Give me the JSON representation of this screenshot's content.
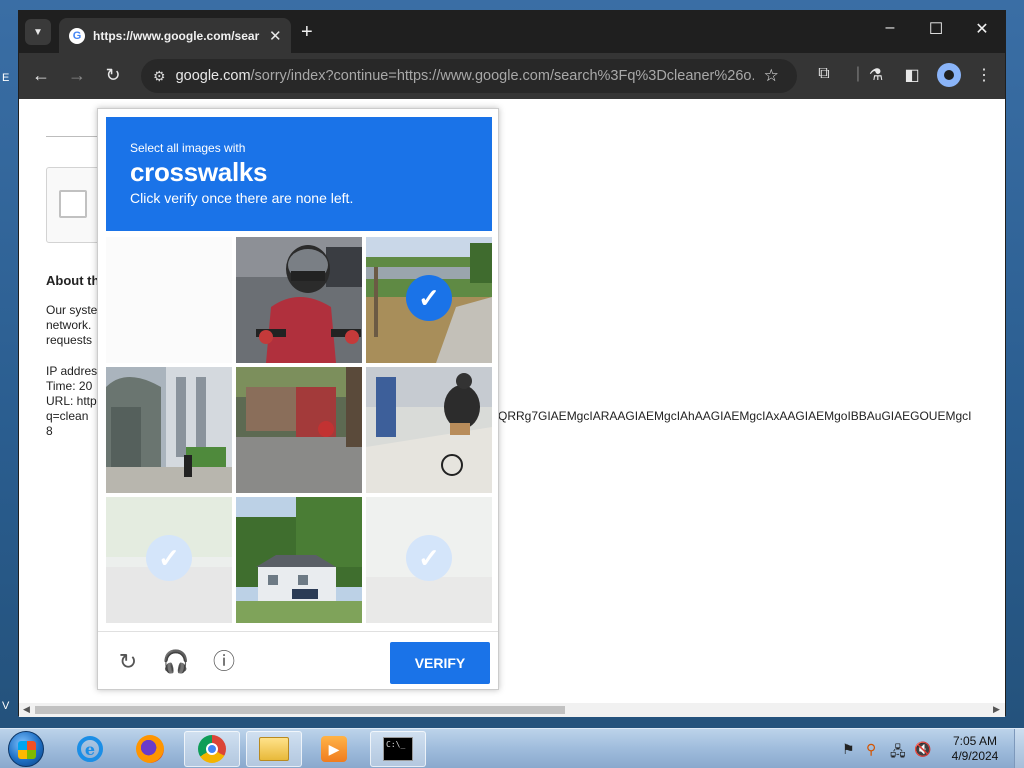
{
  "desktop": {
    "stub_left_1": "E",
    "stub_left_2": "V"
  },
  "browser": {
    "tab_title": "https://www.google.com/sear",
    "tab_favicon": "G",
    "url_host": "google.com",
    "url_rest": "/sorry/index?continue=https://www.google.com/search%3Fq%3Dcleaner%26o..."
  },
  "page": {
    "about_heading": "About th",
    "para_lines": [
      "Our syste",
      "network.",
      "requests"
    ],
    "ip_lines": [
      "IP addres",
      "Time: 20",
      "URL: http",
      "q=clean",
      "8"
    ],
    "url_tail": "QRRg7GIAEMgcIARAAGIAEMgcIAhAAGIAEMgcIAxAAGIAEMgoIBBAuGIAEGOUEMgcI"
  },
  "captcha": {
    "line1": "Select all images with",
    "keyword": "crosswalks",
    "line3": "Click verify once there are none left.",
    "verify_label": "VERIFY",
    "tiles": [
      {
        "name": "tile-1",
        "state": "blank",
        "checked": false
      },
      {
        "name": "tile-2",
        "state": "motorcyclist",
        "checked": false
      },
      {
        "name": "tile-3",
        "state": "road-with-trees",
        "checked": true
      },
      {
        "name": "tile-4",
        "state": "bus-stop-street",
        "checked": false
      },
      {
        "name": "tile-5",
        "state": "street-red-vehicles",
        "checked": false
      },
      {
        "name": "tile-6",
        "state": "cyclist-sidewalk",
        "checked": false
      },
      {
        "name": "tile-7",
        "state": "faded-loading",
        "checked": true
      },
      {
        "name": "tile-8",
        "state": "house-with-trees",
        "checked": false
      },
      {
        "name": "tile-9",
        "state": "faded-loading",
        "checked": true
      }
    ]
  },
  "taskbar": {
    "clock_time": "7:05 AM",
    "clock_date": "4/9/2024",
    "cmd_glyph": "C:\\_"
  },
  "colors": {
    "captcha_blue": "#1a73e8",
    "chrome_dark": "#1f1f1f",
    "toolbar": "#353535"
  }
}
